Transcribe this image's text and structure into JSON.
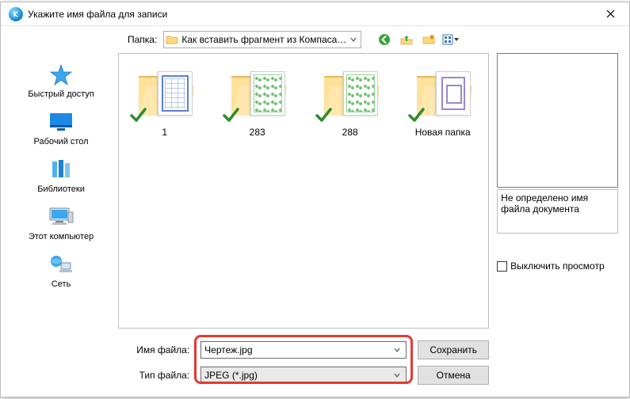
{
  "window": {
    "title": "Укажите имя файла для записи"
  },
  "toolbar": {
    "folder_label": "Папка:",
    "current_path": "Как вставить фрагмент из Компаса в Вор"
  },
  "sidebar": {
    "places": [
      {
        "key": "quick",
        "label": "Быстрый доступ"
      },
      {
        "key": "desktop",
        "label": "Рабочий стол"
      },
      {
        "key": "libs",
        "label": "Библиотеки"
      },
      {
        "key": "thispc",
        "label": "Этот компьютер"
      },
      {
        "key": "network",
        "label": "Сеть"
      }
    ]
  },
  "items": [
    {
      "name": "1",
      "style": "tech-blue"
    },
    {
      "name": "283",
      "style": "tech-green"
    },
    {
      "name": "288",
      "style": "tech-green"
    },
    {
      "name": "Новая папка",
      "style": "tech-purple"
    }
  ],
  "form": {
    "filename_label": "Имя файла:",
    "filetype_label": "Тип файла:",
    "filename_value": "Чертеж.jpg",
    "filetype_value": "JPEG (*.jpg)",
    "save_label": "Сохранить",
    "cancel_label": "Отмена"
  },
  "preview": {
    "message": "Не определено имя файла документа",
    "toggle_label": "Выключить просмотр"
  }
}
